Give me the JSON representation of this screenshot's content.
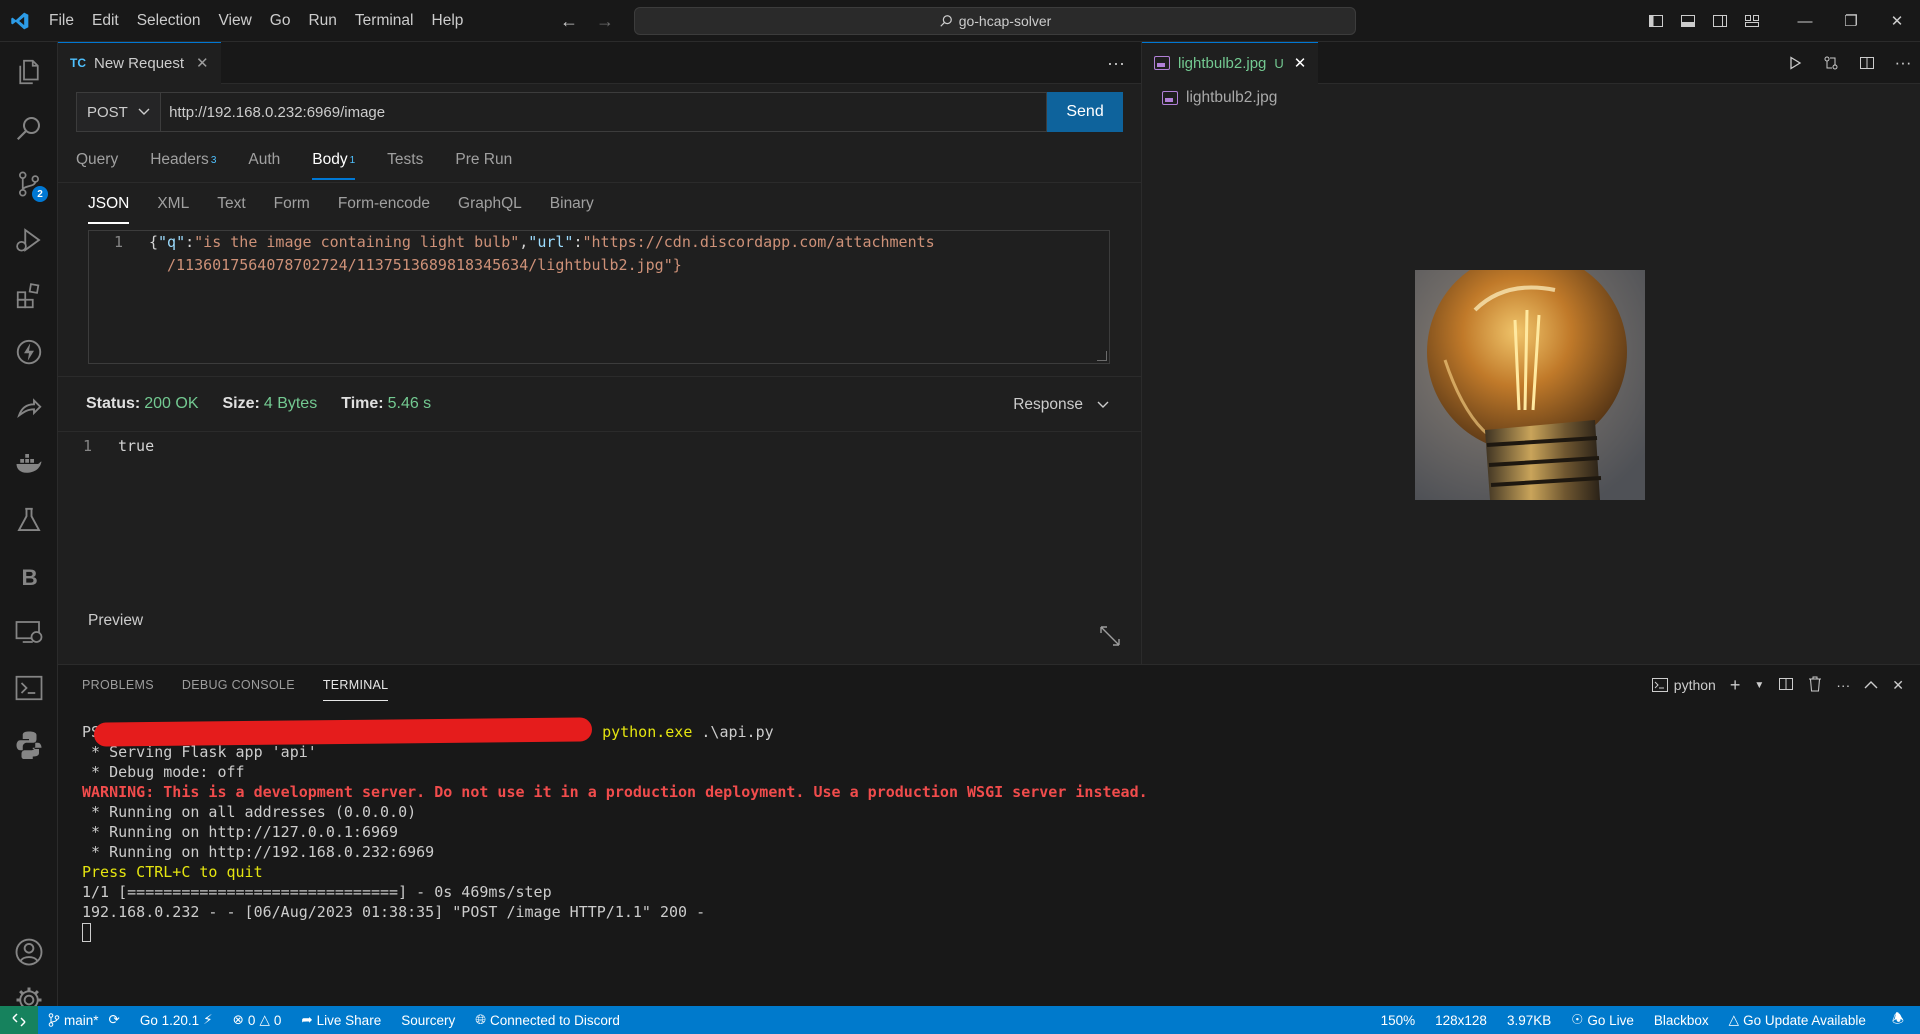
{
  "titlebar": {
    "menu": [
      "File",
      "Edit",
      "Selection",
      "View",
      "Go",
      "Run",
      "Terminal",
      "Help"
    ],
    "search_text": "go-hcap-solver"
  },
  "activity_badge": "2",
  "left_editor": {
    "tab_icon": "TC",
    "tab_title": "New Request",
    "more": "···",
    "method": "POST",
    "url": "http://192.168.0.232:6969/image",
    "send": "Send",
    "req_tabs": [
      {
        "label": "Query",
        "count": ""
      },
      {
        "label": "Headers",
        "count": "3"
      },
      {
        "label": "Auth",
        "count": ""
      },
      {
        "label": "Body",
        "count": "1"
      },
      {
        "label": "Tests",
        "count": ""
      },
      {
        "label": "Pre Run",
        "count": ""
      }
    ],
    "body_tabs": [
      "JSON",
      "XML",
      "Text",
      "Form",
      "Form-encode",
      "GraphQL",
      "Binary"
    ],
    "body_code": {
      "line_no": "1",
      "line1_parts": [
        "{",
        "\"q\"",
        ":",
        "\"is the image containing light bulb\"",
        ",",
        "\"url\"",
        ":",
        "\"https://cdn.discordapp.com/attachments"
      ],
      "line2": "/1136017564078702724/1137513689818345634/lightbulb2.jpg\"}"
    },
    "status_label": "Status:",
    "status_value": "200 OK",
    "size_label": "Size:",
    "size_value": "4 Bytes",
    "time_label": "Time:",
    "time_value": "5.46 s",
    "response_dropdown": "Response",
    "response_line_no": "1",
    "response_body": "true",
    "preview": "Preview"
  },
  "right_editor": {
    "tab_title": "lightbulb2.jpg",
    "tab_status": "U",
    "breadcrumb": "lightbulb2.jpg"
  },
  "panel": {
    "tabs": [
      "PROBLEMS",
      "DEBUG CONSOLE",
      "TERMINAL"
    ],
    "terminal_profile": "python",
    "terminal_lines": {
      "prompt_start": "PS",
      "cmd": "python.exe",
      "cmd_arg": " .\\api.py",
      "l1": " * Serving Flask app 'api'",
      "l2": " * Debug mode: off",
      "warning": "WARNING: This is a development server. Do not use it in a production deployment. Use a production WSGI server instead.",
      "l3": " * Running on all addresses (0.0.0.0)",
      "l4": " * Running on http://127.0.0.1:6969",
      "l5": " * Running on http://192.168.0.232:6969",
      "quit": "Press CTRL+C to quit",
      "l6": "1/1 [==============================] - 0s 469ms/step",
      "l7": "192.168.0.232 - - [06/Aug/2023 01:38:35] \"POST /image HTTP/1.1\" 200 -"
    }
  },
  "statusbar": {
    "branch": "main*",
    "go_version": "Go 1.20.1",
    "errors": "0",
    "warnings": "0",
    "live_share": "Live Share",
    "sourcery": "Sourcery",
    "discord": "Connected to Discord",
    "zoom": "150%",
    "dims": "128x128",
    "filesize": "3.97KB",
    "go_live": "Go Live",
    "blackbox": "Blackbox",
    "go_update": "Go Update Available"
  }
}
